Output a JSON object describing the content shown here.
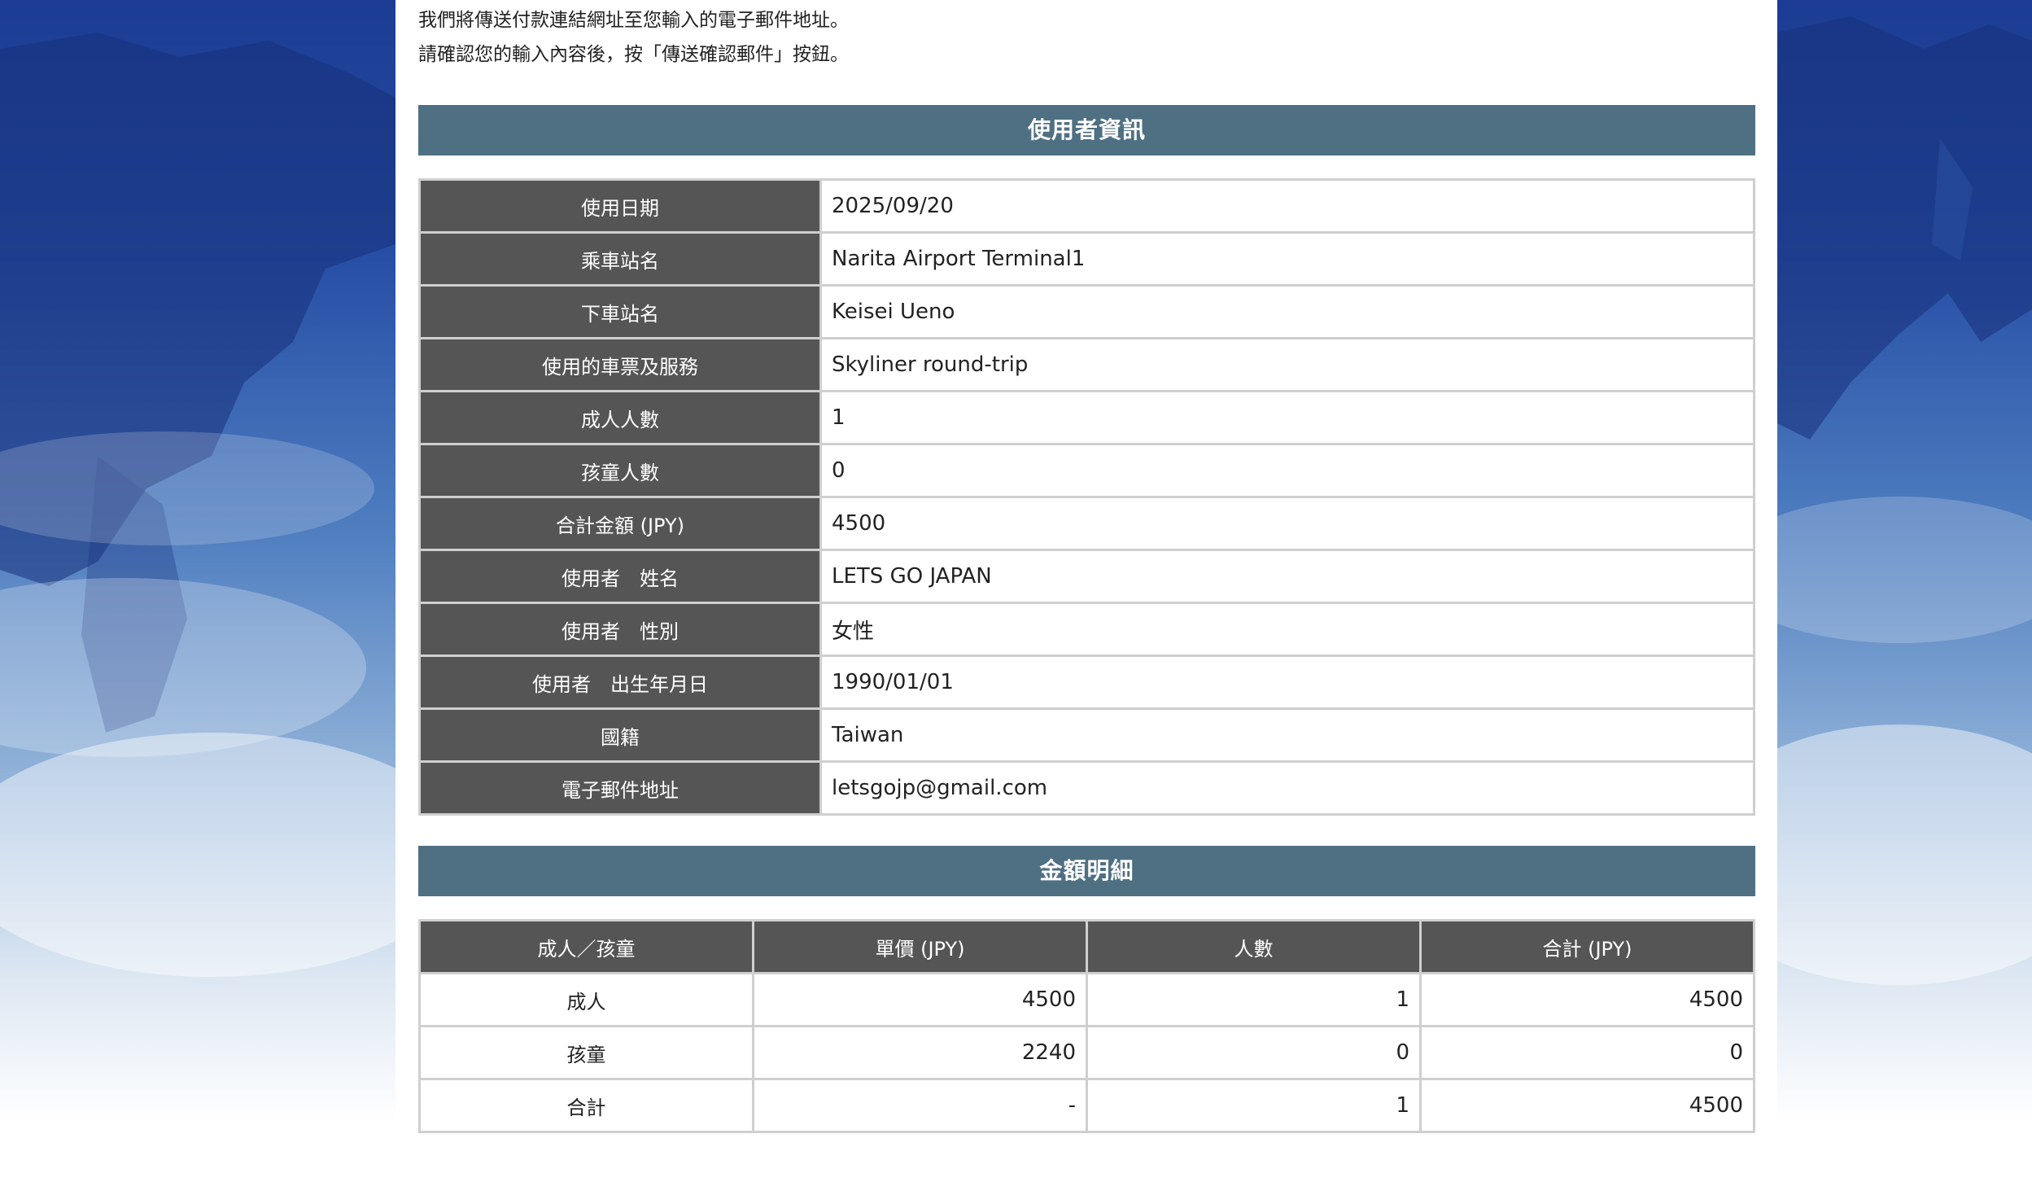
{
  "intro": {
    "line1": "我們將傳送付款連結網址至您輸入的電子郵件地址。",
    "line2": "請確認您的輸入內容後，按「傳送確認郵件」按鈕。"
  },
  "user_section": {
    "title": "使用者資訊",
    "rows": [
      {
        "label": "使用日期",
        "value": "2025/09/20"
      },
      {
        "label": "乘車站名",
        "value": "Narita Airport Terminal1"
      },
      {
        "label": "下車站名",
        "value": "Keisei Ueno"
      },
      {
        "label": "使用的車票及服務",
        "value": "Skyliner round-trip"
      },
      {
        "label": "成人人數",
        "value": "1"
      },
      {
        "label": "孩童人數",
        "value": "0"
      },
      {
        "label": "合計金額 (JPY)",
        "value": "4500"
      },
      {
        "label": "使用者　姓名",
        "value": "LETS GO JAPAN"
      },
      {
        "label": "使用者　性別",
        "value": "女性"
      },
      {
        "label": "使用者　出生年月日",
        "value": "1990/01/01"
      },
      {
        "label": "國籍",
        "value": "Taiwan"
      },
      {
        "label": "電子郵件地址",
        "value": "letsgojp@gmail.com"
      }
    ]
  },
  "price_section": {
    "title": "金額明細",
    "headers": [
      "成人／孩童",
      "單價 (JPY)",
      "人數",
      "合計 (JPY)"
    ],
    "rows": [
      {
        "type": "成人",
        "unit_price": "4500",
        "count": "1",
        "total": "4500"
      },
      {
        "type": "孩童",
        "unit_price": "2240",
        "count": "0",
        "total": "0"
      },
      {
        "type": "合計",
        "unit_price": "-",
        "count": "1",
        "total": "4500"
      }
    ]
  },
  "colors": {
    "section_bar": "#4f7083",
    "label_cell": "#555555",
    "border": "#cfcfcf",
    "background_top": "#1c3c93"
  }
}
